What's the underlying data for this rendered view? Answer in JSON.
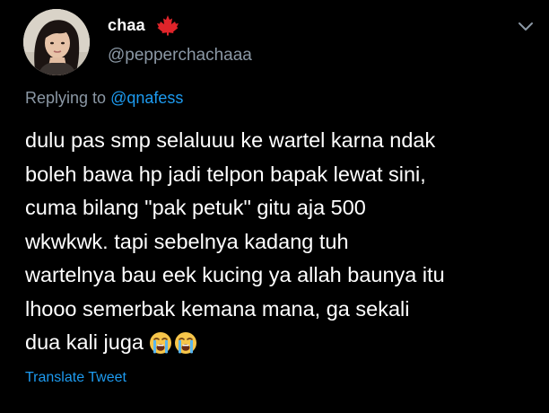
{
  "user": {
    "display_name": "chaa",
    "handle": "@pepperchachaaa",
    "flag_icon": "maple-leaf-icon"
  },
  "reply": {
    "prefix": "Replying to ",
    "mention": "@qnafess"
  },
  "tweet": {
    "text": "dulu pas smp selaluuu ke wartel karna ndak\nboleh bawa hp jadi telpon bapak lewat sini,\ncuma bilang \"pak petuk\" gitu aja 500\nwkwkwk. tapi sebelnya kadang tuh\nwartelnya bau eek kucing ya allah baunya itu\nlhooo semerbak kemana mana, ga sekali\ndua kali juga",
    "emojis": [
      "loudly-crying-face-icon",
      "loudly-crying-face-icon"
    ]
  },
  "translate_label": "Translate Tweet",
  "menu_icon": "chevron-down-icon",
  "colors": {
    "background": "#000000",
    "text": "#ffffff",
    "secondary": "#8b98a5",
    "link": "#1d9bf0",
    "flag": "#e0242a"
  }
}
